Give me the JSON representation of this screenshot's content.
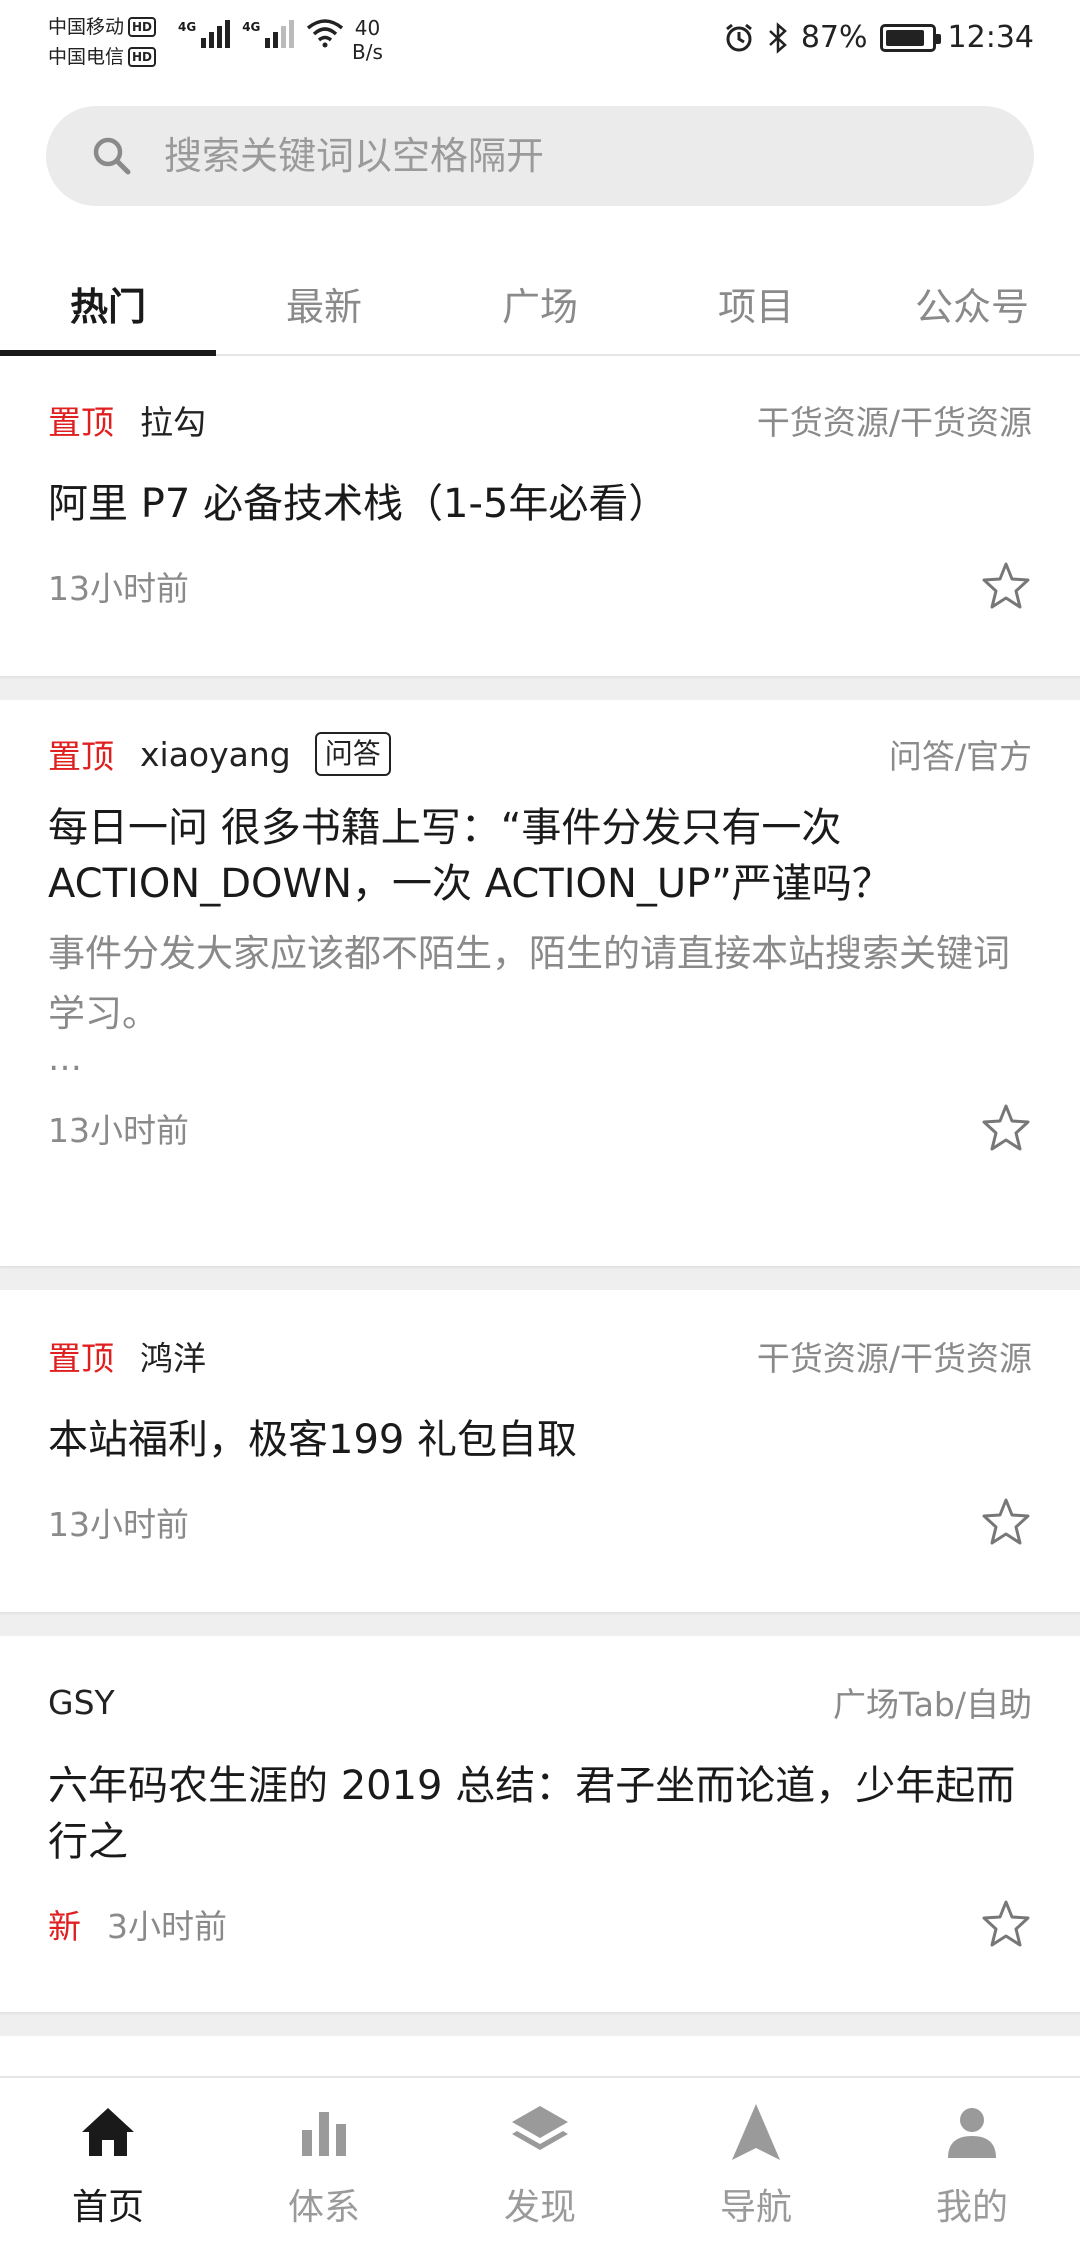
{
  "status_bar": {
    "carrier1": "中国移动",
    "carrier2": "中国电信",
    "hd": "HD",
    "network1": "4G",
    "network2": "4G",
    "speed_value": "40",
    "speed_unit": "B/s",
    "battery": "87%",
    "battery_level": 0.87,
    "time": "12:34"
  },
  "search": {
    "placeholder": "搜索关键词以空格隔开"
  },
  "tabs": [
    {
      "label": "热门",
      "active": true
    },
    {
      "label": "最新",
      "active": false
    },
    {
      "label": "广场",
      "active": false
    },
    {
      "label": "项目",
      "active": false
    },
    {
      "label": "公众号",
      "active": false
    }
  ],
  "articles": [
    {
      "sticky": "置顶",
      "author": "拉勾",
      "category": "干货资源/干货资源",
      "title": "阿里 P7 必备技术栈（1-5年必看）",
      "time": "13小时前"
    },
    {
      "sticky": "置顶",
      "author": "xiaoyang",
      "tag": "问答",
      "category": "问答/官方",
      "title": "每日一问 很多书籍上写：“事件分发只有一次ACTION_DOWN，一次 ACTION_UP”严谨吗？",
      "desc": "事件分发大家应该都不陌生，陌生的请直接本站搜索关键词学习。",
      "ellipsis": "…",
      "time": "13小时前"
    },
    {
      "sticky": "置顶",
      "author": "鸿洋",
      "category": "干货资源/干货资源",
      "title": "本站福利，极客199 礼包自取",
      "time": "13小时前"
    },
    {
      "author": "GSY",
      "category": "广场Tab/自助",
      "title": "六年码农生涯的 2019 总结：君子坐而论道，少年起而行之",
      "new": "新",
      "time": "3小时前"
    }
  ],
  "bottom_nav": [
    {
      "label": "首页",
      "icon": "home-icon",
      "active": true
    },
    {
      "label": "体系",
      "icon": "bar-chart-icon",
      "active": false
    },
    {
      "label": "发现",
      "icon": "layers-icon",
      "active": false
    },
    {
      "label": "导航",
      "icon": "navigation-icon",
      "active": false
    },
    {
      "label": "我的",
      "icon": "person-icon",
      "active": false
    }
  ],
  "colors": {
    "accent_red": "#e02020",
    "text_primary": "#1a1a1a",
    "text_secondary": "#8a8a8a",
    "feed_background": "#efefef"
  }
}
